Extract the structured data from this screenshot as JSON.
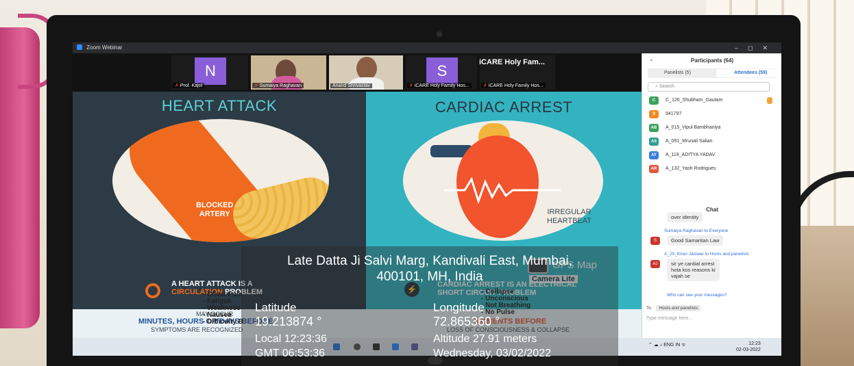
{
  "zoom": {
    "window_title": "Zoom Webinar",
    "speaker_label": "iCARE Holy Fam...",
    "thumbnails": [
      {
        "initial": "N",
        "name": "Prof. Kajol"
      },
      {
        "name": "Sumaiya Raghavan"
      },
      {
        "name": "Anand Shrivastav"
      },
      {
        "initial": "S",
        "name": "iCARE Holy Family Hos..."
      },
      {
        "name": "iCARE Holy Family Hos..."
      }
    ]
  },
  "slide": {
    "left_title": "HEART ATTACK",
    "left_circle_label_1": "BLOCKED",
    "left_circle_label_2": "ARTERY",
    "left_headline_1": "A HEART ATTACK IS A",
    "left_headline_2a": "CIRCULATION",
    "left_headline_2b": " PROBLEM",
    "left_may_occur": "MAY OCCUR",
    "left_timing": "MINUTES, HOURS OR DAYS BEFORE",
    "left_recognized": "SYMPTOMS ARE RECOGNIZED",
    "left_symptoms": [
      "- Chest Pain",
      "- Fatigue",
      "- Weakness",
      "- Nausea",
      "- Difficulty B"
    ],
    "right_title": "CARDIAC ARREST",
    "right_circle_label_1": "IRREGULAR",
    "right_circle_label_2": "HEARTBEAT",
    "right_headline_1": "CARDIAC ARREST IS AN ELECTRICAL",
    "right_headline_2": "SHORT CIRCUIT PROBLEM",
    "right_moments": "MOMENTS BEFORE",
    "right_consciousness": "LOSS OF CONSCIOUSNESS & COLLAPSE",
    "right_symptoms": [
      "- Collapse",
      "- Unconscious",
      "- Not Breathing",
      "- No Pulse"
    ]
  },
  "participants": {
    "header": "Participants (64)",
    "tab_panelists": "Panelists (5)",
    "tab_attendees": "Attendees (59)",
    "search_placeholder": "Search",
    "list": [
      {
        "initials": "C",
        "name": "C_126_Shubham_Gautam",
        "color": "#3aa35b"
      },
      {
        "initials": "9",
        "name": "941797",
        "color": "#f08a24"
      },
      {
        "initials": "AB",
        "name": "A_015_Vipul Bambhaniya",
        "color": "#3aa35b"
      },
      {
        "initials": "AS",
        "name": "A_091_Mrunali Salian",
        "color": "#2e9e8f"
      },
      {
        "initials": "AY",
        "name": "A_118_ADITYA YADAV",
        "color": "#3b7ddd"
      },
      {
        "initials": "AR",
        "name": "A_132_Yash Rodrigues",
        "color": "#e0583a"
      }
    ]
  },
  "chat": {
    "header": "Chat",
    "msg1_text": "over identity",
    "msg2_meta": "Sumaiya Raghavan to Everyone",
    "msg2_avatar": "S",
    "msg2_text": "Good Samaritan Law",
    "msg3_meta": "A_20_Kiran Jaiswar to Hosts and panelists",
    "msg3_avatar": "AJ",
    "msg3_text_1": "sir ye cardial arrest",
    "msg3_text_2": "hota kos reasons ki",
    "msg3_text_3": "vajah se",
    "who_can_see": "Who can see your messages?",
    "to_label": "To:",
    "to_value": "Hosts and panelists",
    "input_placeholder": "Type message here..."
  },
  "taskbar": {
    "lang_1": "ENG",
    "lang_2": "IN",
    "time": "12:23",
    "date": "02-03-2022"
  },
  "gps": {
    "app_name": "GPS Map",
    "app_sub": "Camera Lite",
    "address_line_1": "Late Datta Ji Salvi Marg, Kandivali East, Mumbai,",
    "address_line_2": "400101, MH, India",
    "latitude_label": "Latitude",
    "latitude_value": "19.213874 °",
    "longitude_label": "Longitude",
    "longitude_value": "72.865360 °",
    "local_time": "Local 12:23:36",
    "gmt_time": "GMT 06:53:36",
    "altitude": "Altitude  27.91 meters",
    "date": "Wednesday, 03/02/2022"
  },
  "colors": {
    "heart_orange": "#ef6a1e",
    "slide_teal": "#33b3c0",
    "slide_dark": "#2c3b45",
    "zoom_blue": "#2d8cff"
  }
}
